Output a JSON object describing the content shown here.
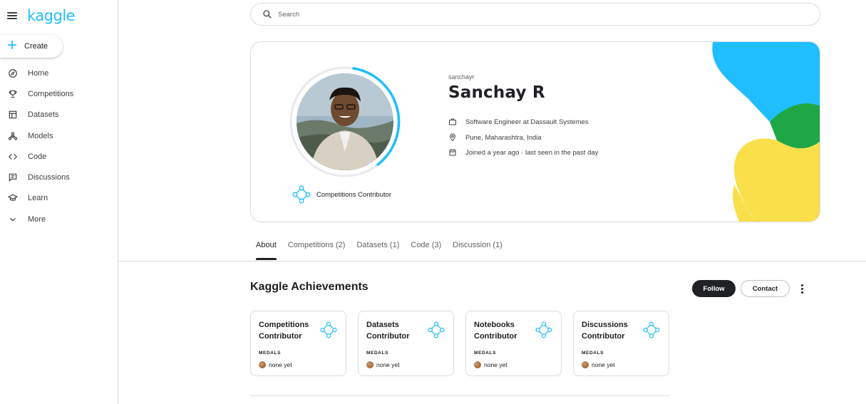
{
  "sidebar": {
    "logo": "kaggle",
    "create_label": "Create",
    "items": [
      {
        "label": "Home",
        "icon": "compass-icon"
      },
      {
        "label": "Competitions",
        "icon": "trophy-icon"
      },
      {
        "label": "Datasets",
        "icon": "table-icon"
      },
      {
        "label": "Models",
        "icon": "models-icon"
      },
      {
        "label": "Code",
        "icon": "code-icon"
      },
      {
        "label": "Discussions",
        "icon": "discussion-icon"
      },
      {
        "label": "Learn",
        "icon": "school-icon"
      },
      {
        "label": "More",
        "icon": "chevron-down-icon"
      }
    ]
  },
  "search": {
    "placeholder": "Search"
  },
  "profile": {
    "username": "sanchayr",
    "name": "Sanchay R",
    "occupation": "Software Engineer at Dassault Systemes",
    "location": "Pune, Maharashtra, India",
    "joined": "Joined a year ago · last seen in the past day",
    "tier": "Competitions Contributor"
  },
  "tabs": [
    {
      "label": "About",
      "active": true
    },
    {
      "label": "Competitions (2)"
    },
    {
      "label": "Datasets (1)"
    },
    {
      "label": "Code (3)"
    },
    {
      "label": "Discussion (1)"
    }
  ],
  "achievements": {
    "title": "Kaggle Achievements",
    "follow_label": "Follow",
    "contact_label": "Contact",
    "cards": [
      {
        "name": "Competitions Contributor",
        "medals_label": "MEDALS",
        "medals_value": "none yet"
      },
      {
        "name": "Datasets Contributor",
        "medals_label": "MEDALS",
        "medals_value": "none yet"
      },
      {
        "name": "Notebooks Contributor",
        "medals_label": "MEDALS",
        "medals_value": "none yet"
      },
      {
        "name": "Discussions Contributor",
        "medals_label": "MEDALS",
        "medals_value": "none yet"
      }
    ]
  },
  "colors": {
    "accent": "#20beff",
    "deco_blue": "#20beff",
    "deco_green": "#20a745",
    "deco_yellow": "#f9e04b"
  }
}
